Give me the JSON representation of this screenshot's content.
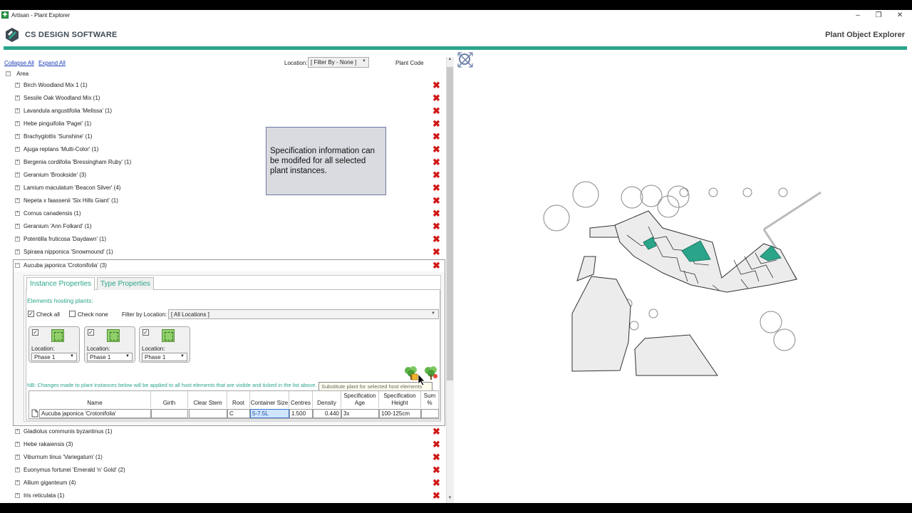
{
  "window": {
    "title": "Artisan - Plant Explorer",
    "min": "–",
    "restore": "❐",
    "close": "✕"
  },
  "header": {
    "brand": "CS DESIGN SOFTWARE",
    "title": "Plant Object Explorer"
  },
  "toolbar": {
    "collapse_all": "Collapse All",
    "expand_all": "Expand All",
    "location_label": "Location:",
    "location_value": "[ Filter By - None ]",
    "plant_code": "Plant Code"
  },
  "tree": {
    "root": "Area",
    "items_top": [
      "Birch Woodland Mix 1 (1)",
      "Sessile Oak Woodland Mix (1)",
      "Lavandula angustifolia 'Melissa' (1)",
      "Hebe pinguifolia 'Pagei' (1)",
      "Brachyglottis 'Sunshine' (1)",
      "Ajuga reptans 'Multi-Color' (1)",
      "Bergenia cordifolia 'Bressingham Ruby' (1)",
      "Geranium 'Brookside' (3)",
      "Lamium maculatum 'Beacon Silver' (4)",
      "Nepeta x faassenii 'Six Hills Giant' (1)",
      "Cornus canadensis (1)",
      "Geranium 'Ann Folkard' (1)",
      "Potentilla fruticosa 'Daydawn' (1)",
      "Spiraea nipponica 'Snowmound' (1)"
    ],
    "expanded_item": "Aucuba japonica 'Crotonifolia' (3)",
    "items_bottom": [
      "Gladiolus communis byzantinus (1)",
      "Hebe rakaiensis (3)",
      "Viburnum tinus 'Variegatum' (1)",
      "Euonymus fortunei 'Emerald 'n' Gold' (2)",
      "Allium giganteum (4)",
      "Iris reticulata (1)"
    ]
  },
  "panel": {
    "tab_instance": "Instance Properties",
    "tab_type": "Type Properties",
    "elements_hosting": "Elements hosting plants:",
    "check_all": "Check all",
    "check_none": "Check none",
    "filter_label": "Filter by Location:",
    "filter_value": "[ All Locations ]",
    "cards": [
      {
        "location_label": "Location:",
        "phase": "Phase 1"
      },
      {
        "location_label": "Location:",
        "phase": "Phase 1"
      },
      {
        "location_label": "Location:",
        "phase": "Phase 1"
      }
    ],
    "nb": "NB: Changes made to plant instances below will be applied to all host elements that are visible and ticked in the list above.",
    "tooltip": "Substitute plant for selected host elements",
    "grid": {
      "headers": [
        "Name",
        "Girth",
        "Clear Stem",
        "Root",
        "Container Size",
        "Centres",
        "Density",
        "Specification Age",
        "Specification Height",
        "Sum %"
      ],
      "row": [
        "Aucuba japonica 'Crotonifolia'",
        "",
        "",
        "C",
        "5-7.5L",
        "1.500",
        "0.440",
        "3x",
        "100-125cm",
        ""
      ]
    }
  },
  "callout": "Specification information can be modifed for all selected plant instances."
}
